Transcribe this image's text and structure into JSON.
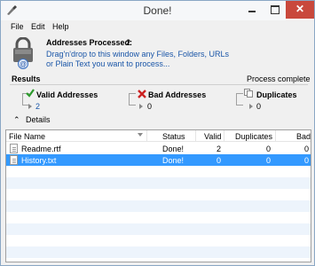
{
  "window": {
    "title": "Done!"
  },
  "menu": {
    "items": [
      "File",
      "Edit",
      "Help"
    ]
  },
  "summary": {
    "addresses_label": "Addresses Processed:",
    "addresses_count": "2",
    "drag_text": "Drag'n'drop to this window any Files, Folders, URLs or Plain Text you want to process..."
  },
  "results": {
    "heading": "Results",
    "status": "Process complete",
    "valid": {
      "label": "Valid Addresses",
      "value": "2",
      "color": "#2b9a2b"
    },
    "bad": {
      "label": "Bad Addresses",
      "value": "0",
      "color": "#cc2222"
    },
    "duplicates": {
      "label": "Duplicates",
      "value": "0"
    }
  },
  "details": {
    "toggle": "⌃",
    "label": "Details"
  },
  "table": {
    "columns": [
      "File Name",
      "Status",
      "Valid",
      "Duplicates",
      "Bad"
    ],
    "rows": [
      {
        "name": "Readme.rtf",
        "status": "Done!",
        "valid": "2",
        "duplicates": "0",
        "bad": "0",
        "selected": false
      },
      {
        "name": "History.txt",
        "status": "Done!",
        "valid": "0",
        "duplicates": "0",
        "bad": "0",
        "selected": true
      }
    ]
  },
  "colors": {
    "selection": "#3399ff",
    "link": "#1a56a8",
    "close": "#c9483c"
  }
}
